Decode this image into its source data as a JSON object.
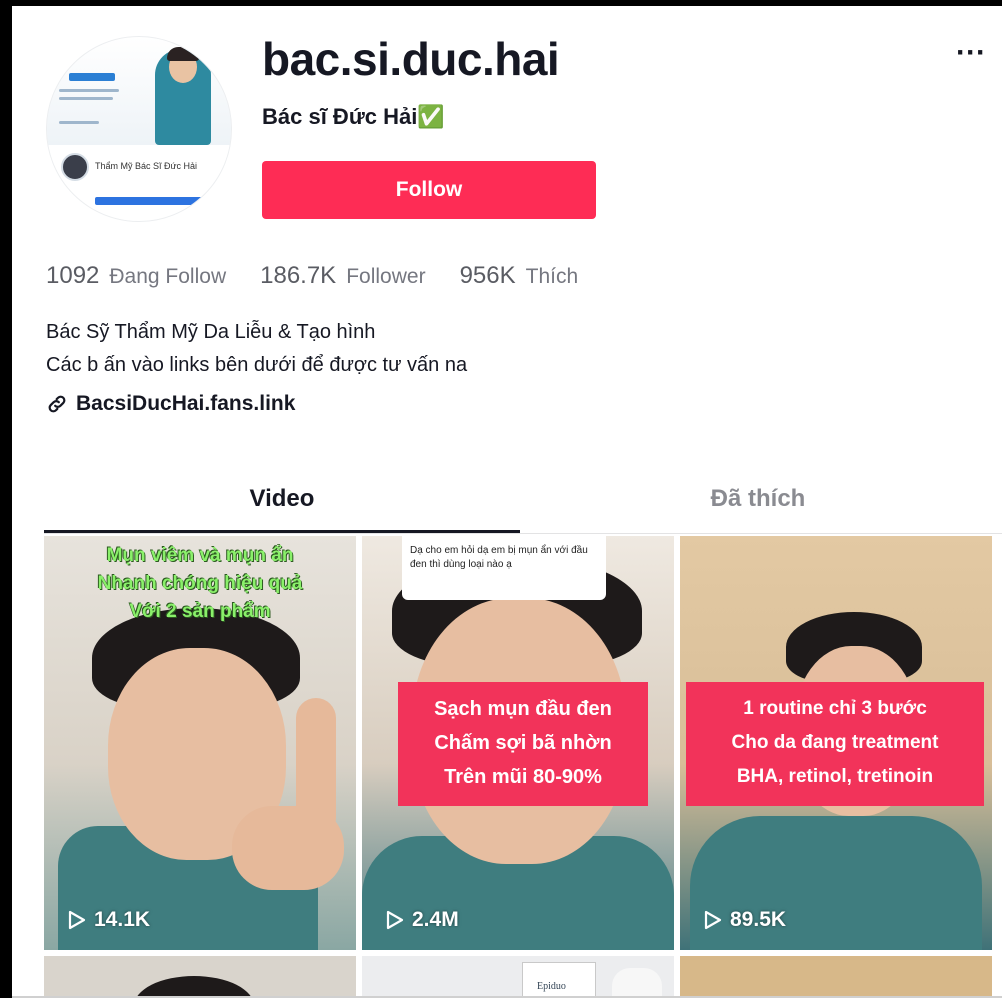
{
  "profile": {
    "username": "bac.si.duc.hai",
    "nickname": "Bác sĩ Đức Hải✅",
    "follow_label": "Follow",
    "avatar_text": "Thẩm Mỹ Bác Sĩ Đức Hải"
  },
  "stats": [
    {
      "num": "1092",
      "label": "Đang Follow"
    },
    {
      "num": "186.7K",
      "label": "Follower"
    },
    {
      "num": "956K",
      "label": "Thích"
    }
  ],
  "bio": {
    "line1": "Bác Sỹ Thẩm Mỹ Da Liễu & Tạo hình",
    "line2": "Các b ấn vào links bên dưới để được tư vấn na"
  },
  "link": {
    "text": "BacsiDucHai.fans.link"
  },
  "tabs": {
    "video": "Video",
    "liked": "Đã thích"
  },
  "videos": [
    {
      "caption": [
        "Mụn viêm và mụn ẩn",
        "Nhanh chóng hiệu quả",
        "Với 2 sản phẩm"
      ],
      "views": "14.1K"
    },
    {
      "question": "Dạ cho em hỏi dạ em bị mụn ẩn với đầu đen thì dùng loại nào ạ",
      "caption": [
        "Sạch mụn đầu đen",
        "Chấm sợi bã nhờn",
        "Trên mũi 80-90%"
      ],
      "views": "2.4M"
    },
    {
      "caption": [
        "1 routine chỉ 3 bước",
        "Cho da đang treatment",
        "BHA, retinol, tretinoin"
      ],
      "views": "89.5K"
    }
  ],
  "partial_label": "Epiduo",
  "colors": {
    "accent": "#fe2c55",
    "caption_red": "#f2335a",
    "caption_green": "#8af06a"
  },
  "icons": {
    "more": "more-horizontal-icon",
    "link": "link-icon",
    "play": "play-icon"
  }
}
